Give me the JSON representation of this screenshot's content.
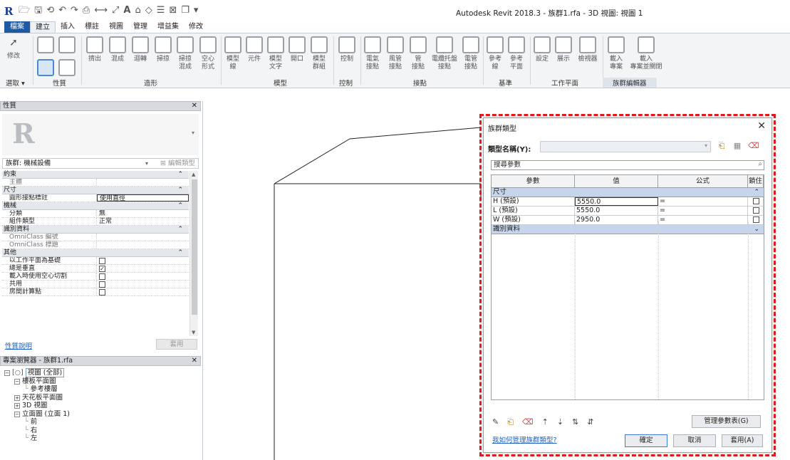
{
  "app": {
    "title": "Autodesk Revit 2018.3 -   族群1.rfa - 3D 視圖: 視圖 1",
    "logo": "R"
  },
  "ribbon": {
    "tabs": [
      "檔案",
      "建立",
      "插入",
      "標註",
      "視圖",
      "管理",
      "增益集",
      "修改"
    ],
    "active_tab": "建立",
    "buttons": {
      "modify": "修改",
      "extrude": "擠出",
      "blend": "混成",
      "revolve": "迴轉",
      "sweep": "掃掠",
      "swept_blend": "掃掠\n混成",
      "void_forms": "空心\n形式",
      "model_line": "模型\n線",
      "component": "元件",
      "model_text": "模型\n文字",
      "opening": "開口",
      "model_group": "模型\n群組",
      "control": "控制",
      "elec_connector": "電氣\n接點",
      "duct_connector": "風管\n接點",
      "pipe_connector": "管\n接點",
      "cable_tray_connector": "電纜托盤\n接點",
      "conduit_connector": "電管\n接點",
      "ref_line": "參考\n線",
      "ref_plane": "參考\n平面",
      "set": "設定",
      "show": "展示",
      "viewer": "檢視器",
      "load_into_project": "載入\n專案",
      "load_into_project_close": "載入\n專案並關閉"
    },
    "panels": {
      "select": "選取 ▾",
      "properties": "性質",
      "forms": "造形",
      "model": "模型",
      "control": "控制",
      "connectors": "接點",
      "datum": "基準",
      "work_plane": "工作平面",
      "family_editor": "族群編輯器"
    }
  },
  "properties": {
    "title": "性質",
    "type_selector": "族群: 機械設備",
    "edit_type": "編輯類型",
    "groups": [
      {
        "name": "約束",
        "rows": [
          {
            "k": "主體",
            "v": "",
            "muted": true
          }
        ]
      },
      {
        "name": "尺寸",
        "rows": [
          {
            "k": "圓形接點標註",
            "v": "使用直徑",
            "boxed": true
          }
        ]
      },
      {
        "name": "機械",
        "rows": [
          {
            "k": "分類",
            "v": "無"
          },
          {
            "k": "組件類型",
            "v": "正常"
          }
        ]
      },
      {
        "name": "識別資料",
        "rows": [
          {
            "k": "OmniClass 編號",
            "v": "",
            "muted": true
          },
          {
            "k": "OmniClass 標題",
            "v": "",
            "muted": true
          }
        ]
      },
      {
        "name": "其他",
        "rows": [
          {
            "k": "以工作平面為基礎",
            "check": false
          },
          {
            "k": "總是垂直",
            "check": true
          },
          {
            "k": "載入時使用空心切割",
            "check": false
          },
          {
            "k": "共用",
            "check": false
          },
          {
            "k": "房間計算點",
            "check": false
          }
        ]
      }
    ],
    "help_link": "性質說明",
    "apply": "套用"
  },
  "browser": {
    "title": "專案瀏覽器 - 族群1.rfa",
    "nodes": [
      {
        "label": "視圖 (全部)",
        "depth": 0,
        "toggle": "−",
        "selected": true
      },
      {
        "label": "樓板平面圖",
        "depth": 1,
        "toggle": "−"
      },
      {
        "label": "參考樓層",
        "depth": 2,
        "toggle": ""
      },
      {
        "label": "天花板平面圖",
        "depth": 1,
        "toggle": "+"
      },
      {
        "label": "3D 視圖",
        "depth": 1,
        "toggle": "+"
      },
      {
        "label": "立面圖 (立面 1)",
        "depth": 1,
        "toggle": "−"
      },
      {
        "label": "前",
        "depth": 2,
        "toggle": ""
      },
      {
        "label": "右",
        "depth": 2,
        "toggle": ""
      },
      {
        "label": "左",
        "depth": 2,
        "toggle": ""
      }
    ]
  },
  "dialog": {
    "title": "族群類型",
    "type_name_label": "類型名稱(Y):",
    "search_placeholder": "搜尋參數",
    "columns": [
      "參數",
      "值",
      "公式",
      "鎖住"
    ],
    "groups": [
      {
        "name": "尺寸",
        "expanded": true,
        "rows": [
          {
            "param": "H (預設)",
            "value": "5550.0",
            "formula": "=",
            "lock": false
          },
          {
            "param": "L (預設)",
            "value": "5550.0",
            "formula": "=",
            "lock": false
          },
          {
            "param": "W (預設)",
            "value": "2950.0",
            "formula": "=",
            "lock": false
          }
        ]
      },
      {
        "name": "識別資料",
        "expanded": false,
        "rows": []
      }
    ],
    "manage_lookup": "管理參數表(G)",
    "help_link": "我如何管理族群類型?",
    "ok": "確定",
    "cancel": "取消",
    "apply": "套用(A)"
  }
}
